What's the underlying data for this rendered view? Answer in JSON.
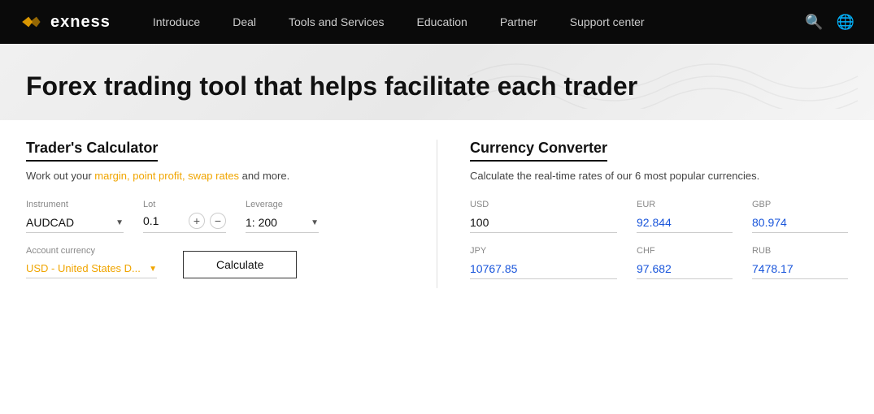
{
  "navbar": {
    "logo_text": "exness",
    "links": [
      {
        "label": "Introduce",
        "id": "introduce"
      },
      {
        "label": "Deal",
        "id": "deal"
      },
      {
        "label": "Tools and Services",
        "id": "tools-and-services"
      },
      {
        "label": "Education",
        "id": "education"
      },
      {
        "label": "Partner",
        "id": "partner"
      },
      {
        "label": "Support center",
        "id": "support-center"
      }
    ]
  },
  "hero": {
    "title": "Forex trading tool that helps facilitate each trader"
  },
  "calculator": {
    "section_title": "Trader's Calculator",
    "description": "Work out your margin, point profit, swap rates and more.",
    "desc_link_text": "margin, point profit, swap rates",
    "instrument_label": "Instrument",
    "instrument_value": "AUDCAD",
    "lot_label": "Lot",
    "lot_value": "0.1",
    "leverage_label": "Leverage",
    "leverage_value": "1: 200",
    "account_currency_label": "Account currency",
    "account_currency_value": "USD - United States D...",
    "calculate_btn": "Calculate"
  },
  "converter": {
    "section_title": "Currency Converter",
    "description": "Calculate the real-time rates of our 6 most popular currencies.",
    "currencies": [
      {
        "label": "USD",
        "value": "100",
        "editable": true
      },
      {
        "label": "EUR",
        "value": "92.844",
        "editable": false
      },
      {
        "label": "GBP",
        "value": "80.974",
        "editable": false
      },
      {
        "label": "JPY",
        "value": "10767.85",
        "editable": false
      },
      {
        "label": "CHF",
        "value": "97.682",
        "editable": false
      },
      {
        "label": "RUB",
        "value": "7478.17",
        "editable": false
      }
    ]
  }
}
